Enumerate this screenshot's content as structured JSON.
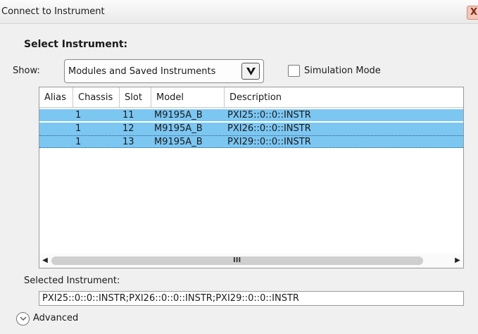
{
  "window": {
    "title": "Connect to Instrument",
    "close_glyph": "X"
  },
  "heading": "Select Instrument:",
  "show": {
    "label": "Show:",
    "value": "Modules and Saved Instruments"
  },
  "simulation": {
    "label": "Simulation Mode",
    "checked": false
  },
  "table": {
    "columns": [
      "Alias",
      "Chassis",
      "Slot",
      "Model",
      "Description"
    ],
    "rows": [
      {
        "alias": "",
        "chassis": "1",
        "slot": "11",
        "model": "M9195A_B",
        "description": "PXI25::0::0::INSTR"
      },
      {
        "alias": "",
        "chassis": "1",
        "slot": "12",
        "model": "M9195A_B",
        "description": "PXI26::0::0::INSTR"
      },
      {
        "alias": "",
        "chassis": "1",
        "slot": "13",
        "model": "M9195A_B",
        "description": "PXI29::0::0::INSTR"
      }
    ],
    "scroll_grip": "III"
  },
  "selected": {
    "label": "Selected Instrument:",
    "value": "PXI25::0::0::INSTR;PXI26::0::0::INSTR;PXI29::0::0::INSTR"
  },
  "advanced": {
    "label": "Advanced",
    "icon": "chevron-down-circle-icon"
  },
  "colors": {
    "selection": "#7cc6f2"
  }
}
